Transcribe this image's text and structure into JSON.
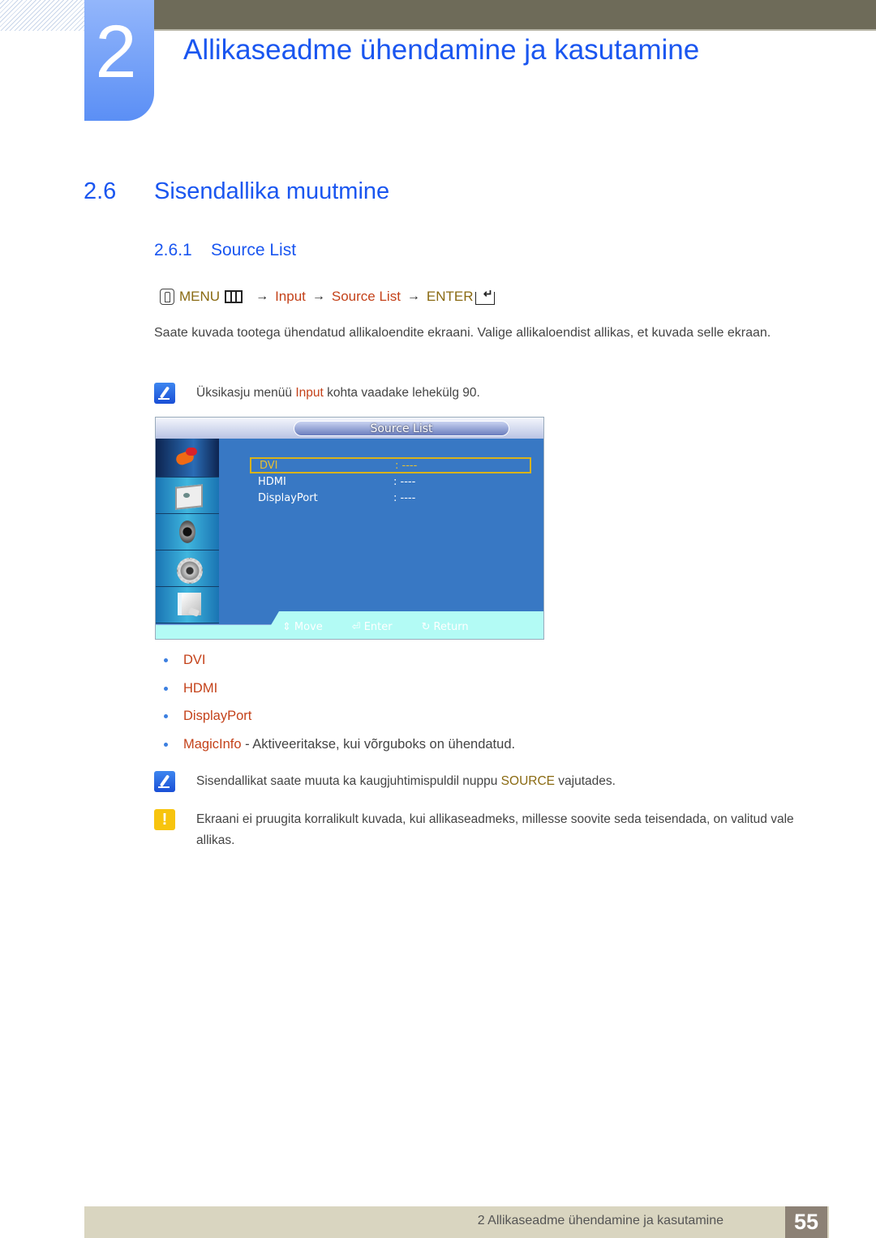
{
  "chapter": {
    "number": "2",
    "title": "Allikaseadme ühendamine ja kasutamine"
  },
  "section": {
    "number": "2.6",
    "title": "Sisendallika muutmine"
  },
  "subsection": {
    "number": "2.6.1",
    "title": "Source List"
  },
  "menu_path": {
    "menu": "MENU",
    "arrow": "→",
    "step1": "Input",
    "step2": "Source List",
    "enter": "ENTER"
  },
  "description": "Saate kuvada tootega ühendatud allikaloendite ekraani. Valige allikaloendist allikas, et kuvada selle ekraan.",
  "note1": {
    "before": "Üksikasju menüü ",
    "term": "Input",
    "after": " kohta vaadake lehekülg 90."
  },
  "osd": {
    "title": "Source List",
    "sidebar": [
      "input-icon",
      "picture-icon",
      "sound-icon",
      "setup-icon",
      "support-icon"
    ],
    "rows": [
      {
        "name": "DVI",
        "value": ": ----",
        "selected": true
      },
      {
        "name": "HDMI",
        "value": ": ----",
        "selected": false
      },
      {
        "name": "DisplayPort",
        "value": ": ----",
        "selected": false
      }
    ],
    "footer": {
      "move": "Move",
      "move_icon": "⇕",
      "enter": "Enter",
      "enter_icon": "⏎",
      "return": "Return",
      "return_icon": "↻"
    }
  },
  "bullets": [
    {
      "term": "DVI",
      "desc": ""
    },
    {
      "term": "HDMI",
      "desc": ""
    },
    {
      "term": "DisplayPort",
      "desc": ""
    },
    {
      "term": "MagicInfo",
      "desc": " - Aktiveeritakse, kui võrguboks on ühendatud."
    }
  ],
  "note2": {
    "before": "Sisendallikat saate muuta ka kaugjuhtimispuldil nuppu ",
    "term": "SOURCE",
    "after": " vajutades."
  },
  "warning": {
    "icon": "!",
    "text": "Ekraani ei pruugita korralikult kuvada, kui allikaseadmeks, millesse soovite seda teisendada, on valitud vale allikas."
  },
  "footer": {
    "text": "2 Allikaseadme ühendamine ja kasutamine",
    "page": "55"
  },
  "colors": {
    "heading_blue": "#1a56f0",
    "term_rust": "#c4421a",
    "term_gold": "#8a6a12",
    "osd_blue": "#3878c4",
    "header_bar": "#6e6b59"
  }
}
